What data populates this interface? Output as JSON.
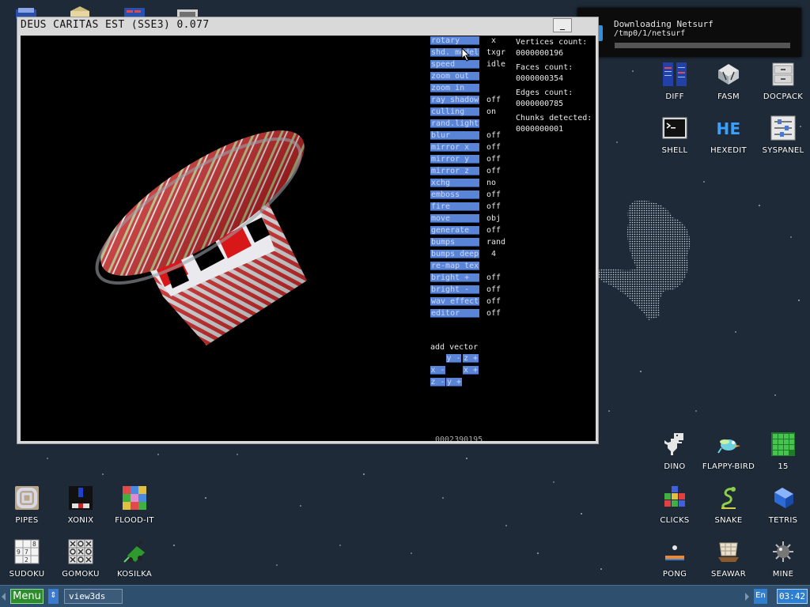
{
  "window": {
    "title": "DEUS CARITAS EST (SSE3) 0.077",
    "minimize_label": "_"
  },
  "notification": {
    "title": "Downloading Netsurf",
    "path": "/tmp0/1/netsurf",
    "progress": 0.0
  },
  "menu_buttons": [
    {
      "label": "rotary",
      "value": "x"
    },
    {
      "label": "shd. model",
      "value": "txgr"
    },
    {
      "label": "speed",
      "value": "idle"
    },
    {
      "label": "zoom out",
      "value": ""
    },
    {
      "label": "zoom in",
      "value": ""
    },
    {
      "label": "ray shadow",
      "value": "off"
    },
    {
      "label": "culling",
      "value": "on"
    },
    {
      "label": "rand.light",
      "value": ""
    },
    {
      "label": "blur",
      "value": "off"
    },
    {
      "label": "mirror x",
      "value": "off"
    },
    {
      "label": "mirror y",
      "value": "off"
    },
    {
      "label": "mirror z",
      "value": "off"
    },
    {
      "label": "xchg",
      "value": "no"
    },
    {
      "label": "emboss",
      "value": "off"
    },
    {
      "label": "fire",
      "value": "off"
    },
    {
      "label": "move",
      "value": "obj"
    },
    {
      "label": "generate",
      "value": "off"
    },
    {
      "label": "bumps",
      "value": "rand"
    },
    {
      "label": "bumps deep",
      "value": "4"
    },
    {
      "label": "re-map tex",
      "value": ""
    },
    {
      "label": "bright +",
      "value": "off"
    },
    {
      "label": "bright -",
      "value": "off"
    },
    {
      "label": "wav effect",
      "value": "off"
    },
    {
      "label": "editor",
      "value": "off"
    }
  ],
  "stats": [
    "Vertices count:",
    "0000000196",
    "Faces count:",
    "0000000354",
    "Edges count:",
    "0000000785",
    "Chunks detected:",
    "0000000001"
  ],
  "add_vector": {
    "label": "add vector",
    "buttons": [
      "y -",
      "z +",
      "x -",
      "x +",
      "z -",
      "y +"
    ]
  },
  "counter": "0002390195",
  "desktop_icons_right_top": [
    {
      "label": "DIFF",
      "icon": "diff-icon"
    },
    {
      "label": "FASM",
      "icon": "fasm-icon"
    },
    {
      "label": "DOCPACK",
      "icon": "docpack-icon"
    },
    {
      "label": "SHELL",
      "icon": "shell-icon"
    },
    {
      "label": "HEXEDIT",
      "icon": "hexedit-icon"
    },
    {
      "label": "SYSPANEL",
      "icon": "syspanel-icon"
    }
  ],
  "desktop_icons_right_bottom": [
    {
      "label": "DINO",
      "icon": "dino-icon"
    },
    {
      "label": "FLAPPY-BIRD",
      "icon": "flappy-bird-icon"
    },
    {
      "label": "15",
      "icon": "fifteen-icon"
    },
    {
      "label": "CLICKS",
      "icon": "clicks-icon"
    },
    {
      "label": "SNAKE",
      "icon": "snake-icon"
    },
    {
      "label": "TETRIS",
      "icon": "tetris-icon"
    },
    {
      "label": "PONG",
      "icon": "pong-icon"
    },
    {
      "label": "SEAWAR",
      "icon": "seawar-icon"
    },
    {
      "label": "MINE",
      "icon": "mine-icon"
    }
  ],
  "desktop_icons_left": [
    {
      "label": "PIPES",
      "icon": "pipes-icon"
    },
    {
      "label": "XONIX",
      "icon": "xonix-icon"
    },
    {
      "label": "FLOOD-IT",
      "icon": "flood-it-icon"
    },
    {
      "label": "SUDOKU",
      "icon": "sudoku-icon"
    },
    {
      "label": "GOMOKU",
      "icon": "gomoku-icon"
    },
    {
      "label": "KOSILKA",
      "icon": "kosilka-icon"
    }
  ],
  "taskbar": {
    "menu_label": "Menu",
    "switch_label": "⇕",
    "task_label": "view3ds",
    "lang": "En",
    "clock": "03:42"
  },
  "colors": {
    "desktop_bg": "#1e2a38",
    "button_bg": "#5a84d6",
    "taskbar_bg": "#2f4f6f",
    "menu_green": "#2e8b2e",
    "clock_blue": "#2f7fd0"
  }
}
